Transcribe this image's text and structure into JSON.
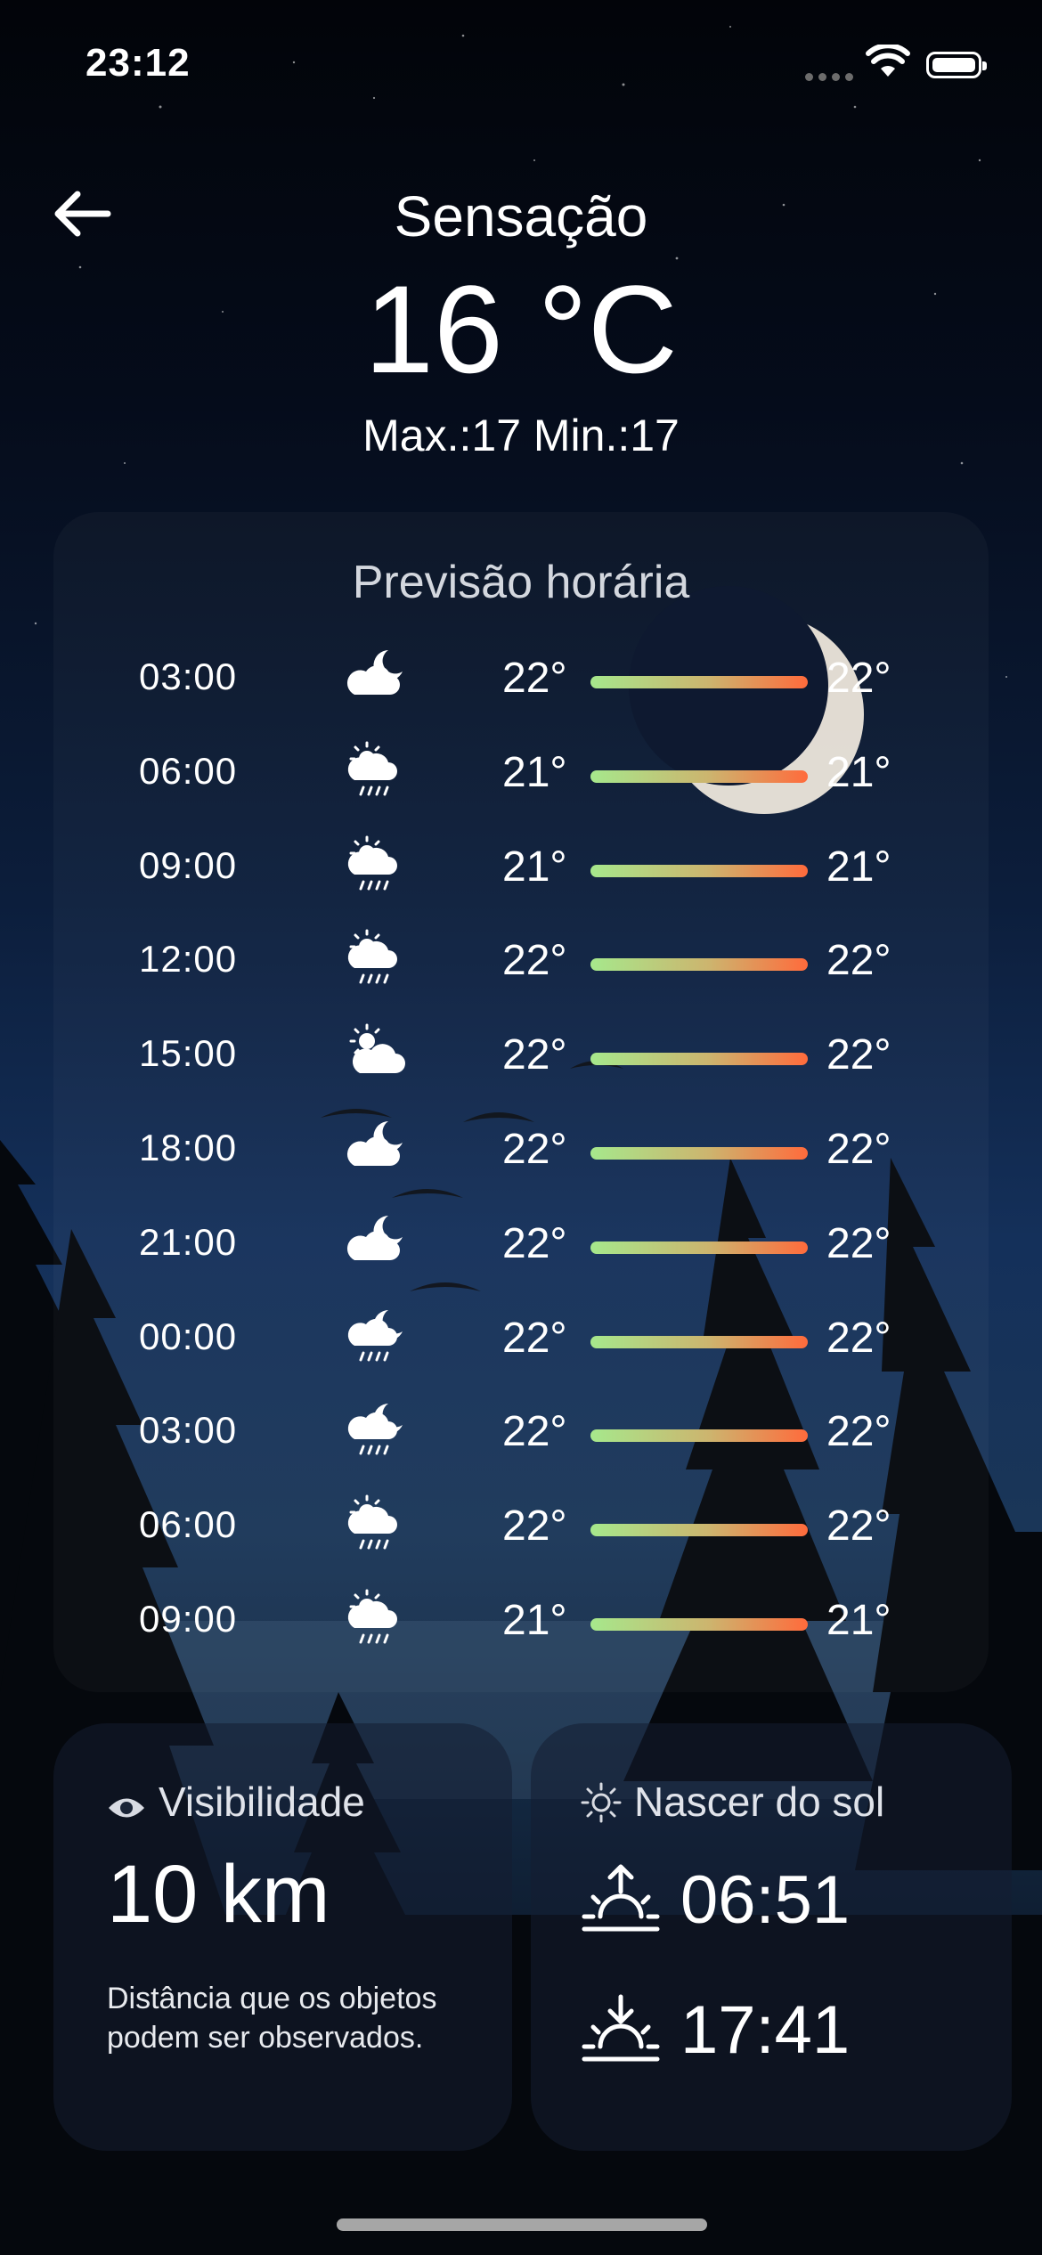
{
  "status_bar": {
    "time": "23:12"
  },
  "header": {
    "label": "Sensação",
    "temperature": "16 °C",
    "range": "Max.:17 Min.:17"
  },
  "hourly": {
    "title": "Previsão horária",
    "rows": [
      {
        "hour": "03:00",
        "icon": "cloud-moon-icon",
        "low": "22°",
        "high": "22°"
      },
      {
        "hour": "06:00",
        "icon": "sun-cloud-rain-icon",
        "low": "21°",
        "high": "21°"
      },
      {
        "hour": "09:00",
        "icon": "sun-cloud-rain-icon",
        "low": "21°",
        "high": "21°"
      },
      {
        "hour": "12:00",
        "icon": "sun-cloud-rain-icon",
        "low": "22°",
        "high": "22°"
      },
      {
        "hour": "15:00",
        "icon": "sun-cloud-icon",
        "low": "22°",
        "high": "22°"
      },
      {
        "hour": "18:00",
        "icon": "cloud-moon-icon",
        "low": "22°",
        "high": "22°"
      },
      {
        "hour": "21:00",
        "icon": "cloud-moon-icon",
        "low": "22°",
        "high": "22°"
      },
      {
        "hour": "00:00",
        "icon": "moon-cloud-rain-icon",
        "low": "22°",
        "high": "22°"
      },
      {
        "hour": "03:00",
        "icon": "moon-cloud-rain-icon",
        "low": "22°",
        "high": "22°"
      },
      {
        "hour": "06:00",
        "icon": "sun-cloud-rain-icon",
        "low": "22°",
        "high": "22°"
      },
      {
        "hour": "09:00",
        "icon": "sun-cloud-rain-icon",
        "low": "21°",
        "high": "21°"
      }
    ]
  },
  "visibility": {
    "label": "Visibilidade",
    "value": "10 km",
    "description": "Distância que os objetos podem ser observados."
  },
  "sun": {
    "label": "Nascer do sol",
    "sunrise": "06:51",
    "sunset": "17:41"
  },
  "colors": {
    "bar_start": "#a6e88c",
    "bar_end": "#ff6b3c"
  }
}
